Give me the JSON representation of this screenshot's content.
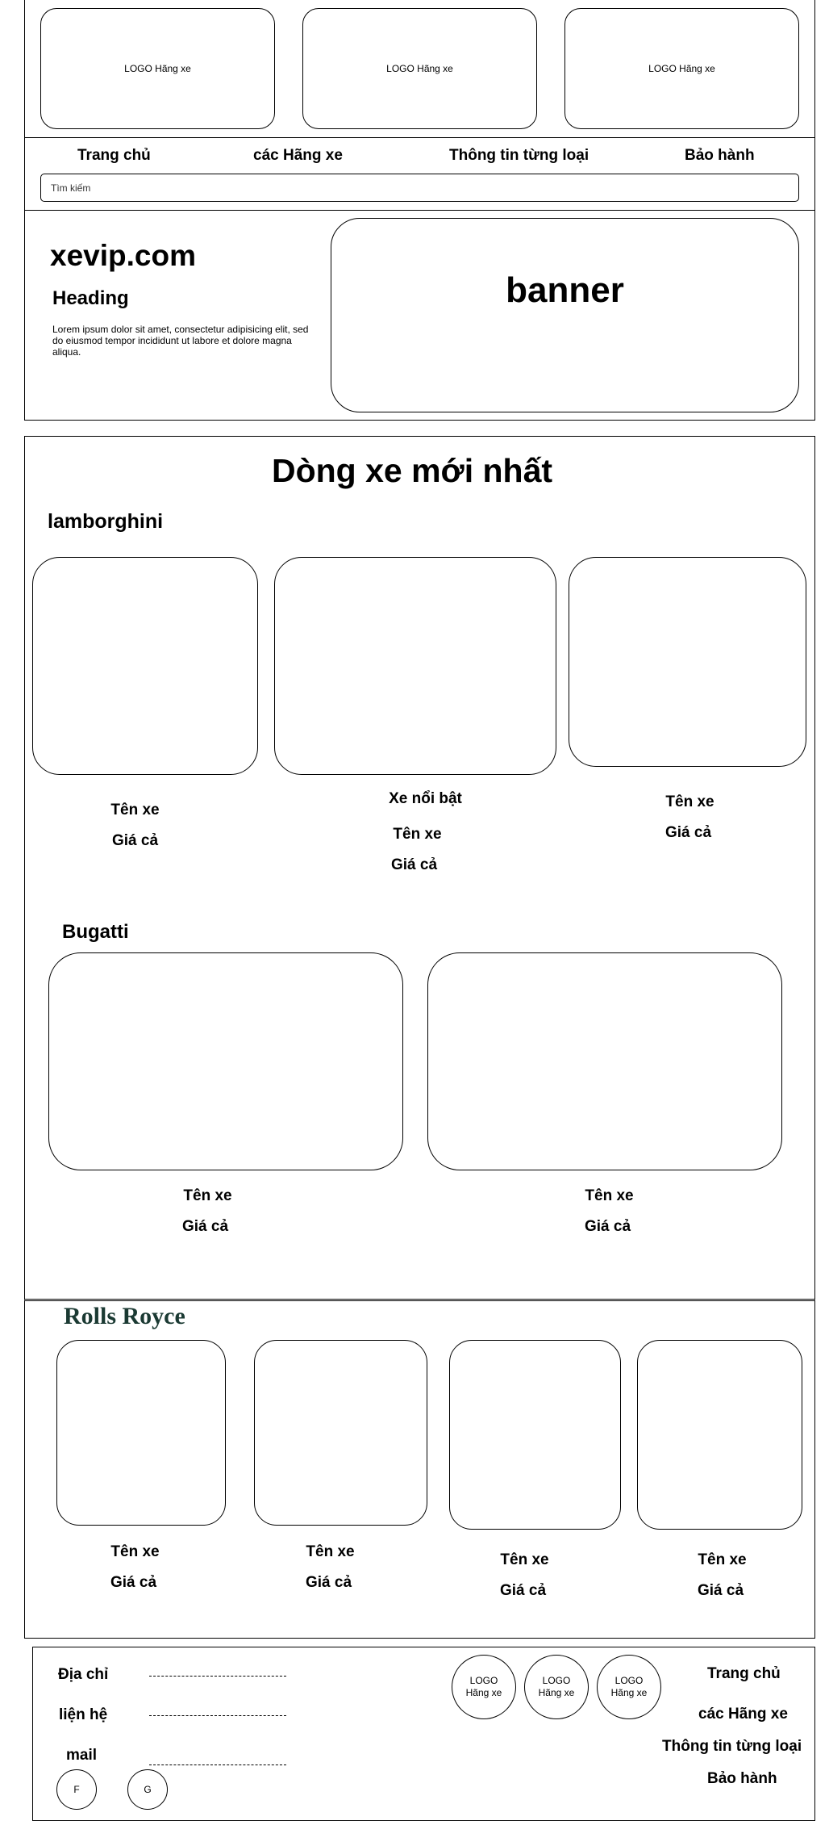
{
  "header": {
    "logos": [
      "LOGO Hãng xe",
      "LOGO Hãng xe",
      "LOGO Hãng xe"
    ]
  },
  "nav": {
    "items": [
      "Trang chủ",
      "các Hãng xe",
      "Thông tin từng loại",
      "Bảo hành"
    ],
    "search_placeholder": "Tìm kiếm"
  },
  "hero": {
    "site_name": "xevip.com",
    "heading": "Heading",
    "body": "Lorem ipsum dolor sit amet, consectetur adipisicing elit, sed do eiusmod tempor incididunt ut labore et dolore magna aliqua.",
    "banner": "banner"
  },
  "latest": {
    "title": "Dòng xe mới nhất",
    "lamborghini": {
      "brand": "lamborghini",
      "featured": "Xe nổi bật",
      "cards": [
        {
          "name": "Tên xe",
          "price": "Giá cả"
        },
        {
          "name": "Tên xe",
          "price": "Giá cả"
        },
        {
          "name": "Tên xe",
          "price": "Giá cả"
        }
      ]
    },
    "bugatti": {
      "brand": "Bugatti",
      "cards": [
        {
          "name": "Tên xe",
          "price": "Giá cả"
        },
        {
          "name": "Tên xe",
          "price": "Giá cả"
        }
      ]
    }
  },
  "rolls": {
    "brand": "Rolls Royce",
    "brand_color": "#1b3a33",
    "cards": [
      {
        "name": "Tên xe",
        "price": "Giá cả"
      },
      {
        "name": "Tên xe",
        "price": "Giá cả"
      },
      {
        "name": "Tên xe",
        "price": "Giá cả"
      },
      {
        "name": "Tên xe",
        "price": "Giá cả"
      }
    ]
  },
  "footer": {
    "address_label": "Địa chỉ",
    "contact_label": "liện hệ",
    "mail_label": "mail",
    "social": [
      "F",
      "G"
    ],
    "logos": [
      "LOGO Hãng xe",
      "LOGO Hãng xe",
      "LOGO Hãng xe"
    ],
    "links": [
      "Trang chủ",
      "các Hãng xe",
      "Thông tin từng loại",
      "Bảo hành"
    ]
  }
}
